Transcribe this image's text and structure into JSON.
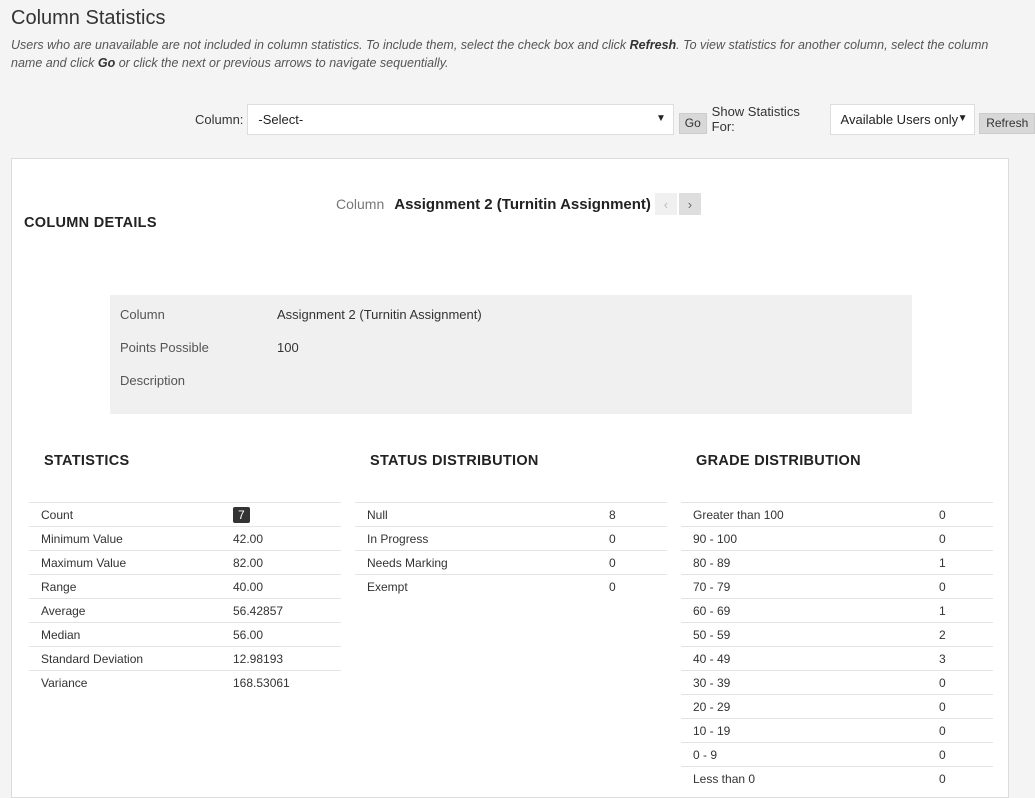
{
  "page": {
    "title": "Column Statistics",
    "instructions_part1": "Users who are unavailable are not included in column statistics. To include them, select the check box and click ",
    "instructions_bold1": "Refresh",
    "instructions_part2": ". To view statistics for another column, select the column name and click ",
    "instructions_bold2": "Go",
    "instructions_part3": " or click the next or previous arrows to navigate sequentially."
  },
  "toolbar": {
    "column_label": "Column:",
    "column_select_value": "-Select-",
    "go_label": "Go",
    "show_stats_label": "Show Statistics For:",
    "show_stats_value": "Available Users only",
    "refresh_label": "Refresh"
  },
  "column_nav": {
    "label": "Column",
    "name": "Assignment 2 (Turnitin Assignment)",
    "prev_icon": "chevron-left-icon",
    "next_icon": "chevron-right-icon"
  },
  "details": {
    "heading": "COLUMN DETAILS",
    "rows": [
      {
        "label": "Column",
        "value": "Assignment 2 (Turnitin Assignment)"
      },
      {
        "label": "Points Possible",
        "value": "100"
      },
      {
        "label": "Description",
        "value": ""
      }
    ]
  },
  "statistics": {
    "heading": "STATISTICS",
    "rows": [
      {
        "label": "Count",
        "value": "7"
      },
      {
        "label": "Minimum Value",
        "value": "42.00"
      },
      {
        "label": "Maximum Value",
        "value": "82.00"
      },
      {
        "label": "Range",
        "value": "40.00"
      },
      {
        "label": "Average",
        "value": "56.42857"
      },
      {
        "label": "Median",
        "value": "56.00"
      },
      {
        "label": "Standard Deviation",
        "value": "12.98193"
      },
      {
        "label": "Variance",
        "value": "168.53061"
      }
    ]
  },
  "status_distribution": {
    "heading": "STATUS DISTRIBUTION",
    "rows": [
      {
        "label": "Null",
        "value": "8"
      },
      {
        "label": "In Progress",
        "value": "0"
      },
      {
        "label": "Needs Marking",
        "value": "0"
      },
      {
        "label": "Exempt",
        "value": "0"
      }
    ]
  },
  "grade_distribution": {
    "heading": "GRADE DISTRIBUTION",
    "rows": [
      {
        "label": "Greater than 100",
        "value": "0"
      },
      {
        "label": "90 - 100",
        "value": "0"
      },
      {
        "label": "80 - 89",
        "value": "1"
      },
      {
        "label": "70 - 79",
        "value": "0"
      },
      {
        "label": "60 - 69",
        "value": "1"
      },
      {
        "label": "50 - 59",
        "value": "2"
      },
      {
        "label": "40 - 49",
        "value": "3"
      },
      {
        "label": "30 - 39",
        "value": "0"
      },
      {
        "label": "20 - 29",
        "value": "0"
      },
      {
        "label": "10 - 19",
        "value": "0"
      },
      {
        "label": "0 - 9",
        "value": "0"
      },
      {
        "label": "Less than 0",
        "value": "0"
      }
    ]
  },
  "colors": {
    "background": "#f4f4f4",
    "panel": "#ffffff",
    "details_box": "#f0f0f0",
    "badge": "#333333"
  }
}
